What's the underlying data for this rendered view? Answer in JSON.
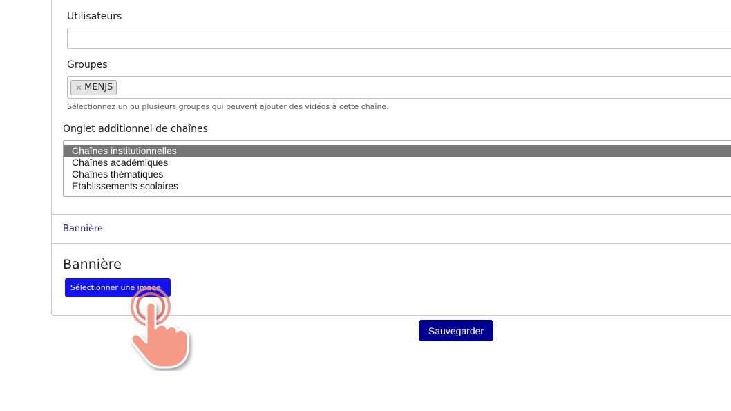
{
  "form": {
    "users_label": "Utilisateurs",
    "users_value": "",
    "groups_label": "Groupes",
    "groups_tags": [
      "MENJS"
    ],
    "tag_remove_glyph": "×",
    "groups_help": "Sélectionnez un ou plusieurs groupes qui peuvent ajouter des vidéos à cette chaîne.",
    "tab_label": "Onglet additionnel de chaînes",
    "tab_options": [
      {
        "label": "Chaînes institutionnelles",
        "selected": true
      },
      {
        "label": "Chaînes académiques",
        "selected": false
      },
      {
        "label": "Chaînes thématiques",
        "selected": false
      },
      {
        "label": "Etablissements scolaires",
        "selected": false
      }
    ]
  },
  "banner": {
    "accordion_label": "Bannière",
    "section_title": "Bannière",
    "select_image_label": "Sélectionner une image"
  },
  "actions": {
    "save_label": "Sauvegarder"
  },
  "colors": {
    "select_button": "#1212ee",
    "save_button": "#000091",
    "link": "#1a1a8a",
    "selected_option": "#767676",
    "tap_pointer": "#f08a78"
  },
  "icons": {
    "pointer": "tap-hand-icon",
    "tag_remove": "close-icon"
  }
}
